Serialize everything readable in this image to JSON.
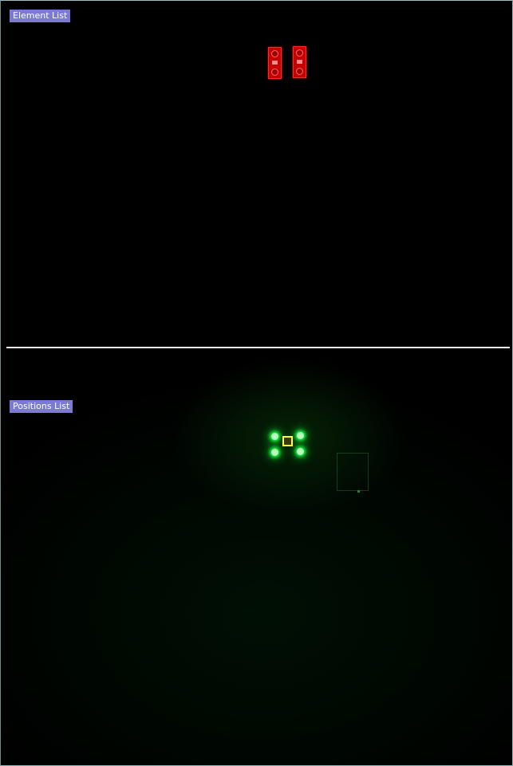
{
  "window": {
    "panels": {
      "element_list": {
        "label": "Element List"
      },
      "positions_list": {
        "label": "Positions List"
      }
    }
  },
  "colors": {
    "label_bg": "#7b7bd6",
    "element_fill": "#c40000",
    "led_glow": "#22ff44",
    "selection_marker": "#ffff33",
    "divider": "#f2f2f2"
  },
  "elements": [
    {
      "icon": "component-icon"
    },
    {
      "icon": "component-icon"
    }
  ],
  "positions": {
    "leds": 4,
    "selected_marker": true
  }
}
